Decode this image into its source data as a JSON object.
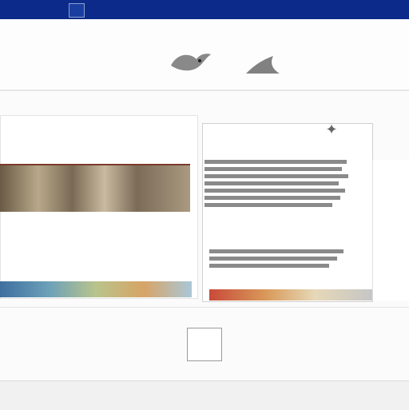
{
  "window": {
    "tab_label": ""
  },
  "banner": {
    "title": ""
  },
  "subline": "",
  "nav_dots": {
    "left": "",
    "mid": ""
  },
  "left": {
    "head": "",
    "title": "",
    "links": [
      "",
      "",
      ""
    ]
  },
  "middle": {
    "title": "",
    "icon_name": "bookmark-icon",
    "item": "",
    "icon_glyph": "✦"
  },
  "right": {
    "top_button": "",
    "links": [
      "",
      "",
      "",
      ""
    ]
  },
  "lower": {
    "left_text": "",
    "mid_text": "",
    "badge": ""
  },
  "footer": {
    "text": ""
  },
  "colors": {
    "topbar": "#0b2a8a",
    "accent": "#7b1e1e",
    "panel_border": "#d0d0d0"
  }
}
